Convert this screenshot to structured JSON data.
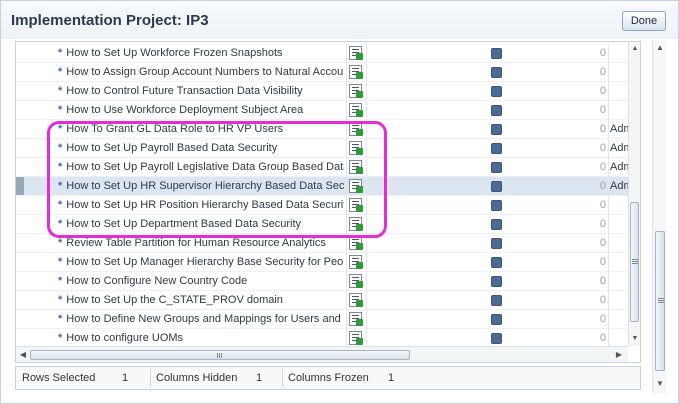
{
  "dialog": {
    "title": "Implementation Project: IP3",
    "done_label": "Done"
  },
  "rows": [
    {
      "name": "How to Set Up Workforce Frozen Snapshots",
      "count": "0",
      "assigned": "",
      "selected": false
    },
    {
      "name": "How to Assign Group Account Numbers to Natural Account",
      "count": "0",
      "assigned": "",
      "selected": false
    },
    {
      "name": "How to Control Future Transaction Data Visibility",
      "count": "0",
      "assigned": "",
      "selected": false
    },
    {
      "name": "How to Use Workforce Deployment Subject Area",
      "count": "0",
      "assigned": "",
      "selected": false
    },
    {
      "name": "How To Grant GL Data Role to HR VP Users",
      "count": "0",
      "assigned": "Adm",
      "selected": false
    },
    {
      "name": "How to Set Up Payroll Based Data Security",
      "count": "0",
      "assigned": "Adm",
      "selected": false
    },
    {
      "name": "How to Set Up Payroll Legislative Data Group Based Data Security",
      "count": "0",
      "assigned": "Adm",
      "selected": false
    },
    {
      "name": "How to Set Up HR Supervisor Hierarchy Based Data Security",
      "count": "0",
      "assigned": "Adm",
      "selected": true
    },
    {
      "name": "How to Set Up HR Position Hierarchy Based Data Security",
      "count": "0",
      "assigned": "",
      "selected": false
    },
    {
      "name": "How to Set Up Department Based Data Security",
      "count": "0",
      "assigned": "",
      "selected": false
    },
    {
      "name": "Review Table Partition for Human Resource Analytics",
      "count": "0",
      "assigned": "",
      "selected": false
    },
    {
      "name": "How to Set Up Manager Hierarchy Base Security for People",
      "count": "0",
      "assigned": "",
      "selected": false
    },
    {
      "name": "How to Configure New Country Code",
      "count": "0",
      "assigned": "",
      "selected": false
    },
    {
      "name": "How to Set Up the C_STATE_PROV domain",
      "count": "0",
      "assigned": "",
      "selected": false
    },
    {
      "name": "How to Define New Groups and Mappings for Users and E",
      "count": "0",
      "assigned": "",
      "selected": false
    },
    {
      "name": "How to configure UOMs",
      "count": "0",
      "assigned": "",
      "selected": false
    }
  ],
  "status_bar": {
    "rows_selected_label": "Rows Selected",
    "rows_selected_value": "1",
    "columns_hidden_label": "Columns Hidden",
    "columns_hidden_value": "1",
    "columns_frozen_label": "Columns Frozen",
    "columns_frozen_value": "1"
  },
  "colors": {
    "highlight": "#e62bd8",
    "selected_row": "#dce6f1",
    "status_icon": "#4c6a96",
    "go_icon": "#2f9a3a"
  },
  "icons": {
    "task_icon": "go-to-task-icon",
    "status_icon": "status-icon",
    "star_marker": "*"
  }
}
